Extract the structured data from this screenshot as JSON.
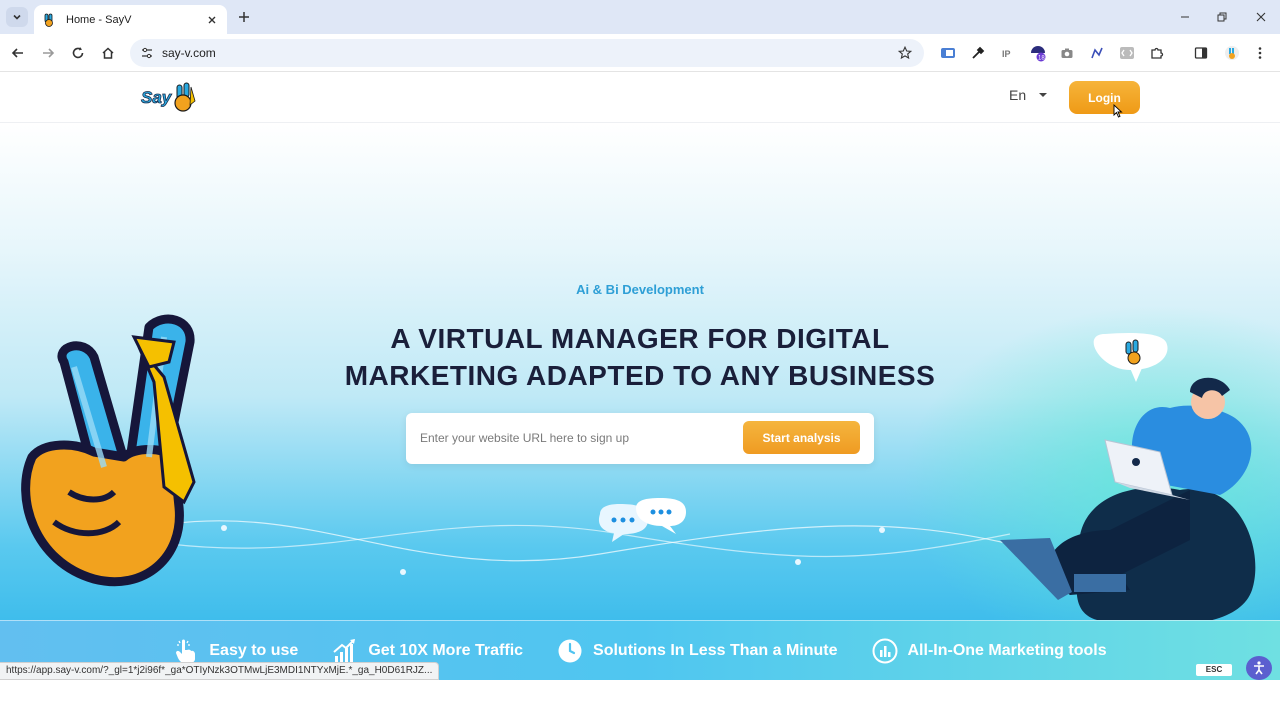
{
  "browser": {
    "tab_title": "Home - SayV",
    "url": "say-v.com",
    "status_url": "https://app.say-v.com/?_gl=1*j2i96f*_ga*OTIyNzk3OTMwLjE3MDI1NTYxMjE.*_ga_H0D61RJZ..."
  },
  "header": {
    "logo_text": "SayV",
    "language": "En",
    "login_label": "Login"
  },
  "hero": {
    "eyebrow": "Ai & Bi Development",
    "headline_line1": "A VIRTUAL MANAGER FOR DIGITAL",
    "headline_line2": "MARKETING ADAPTED TO ANY BUSINESS",
    "input_placeholder": "Enter your website URL here to sign up",
    "start_button": "Start analysis"
  },
  "features": [
    {
      "label": "Easy to use",
      "icon": "pointer-hand-icon"
    },
    {
      "label": "Get 10X More Traffic",
      "icon": "growth-chart-icon"
    },
    {
      "label": "Solutions In Less Than a Minute",
      "icon": "clock-icon"
    },
    {
      "label": "All-In-One Marketing tools",
      "icon": "analytics-icon"
    }
  ],
  "esc_label": "ESC",
  "colors": {
    "accent_orange": "#F0A020",
    "eyebrow_blue": "#2E9FD6",
    "headline_dark": "#1A1F3A",
    "hero_blue": "#3FBDEC"
  }
}
